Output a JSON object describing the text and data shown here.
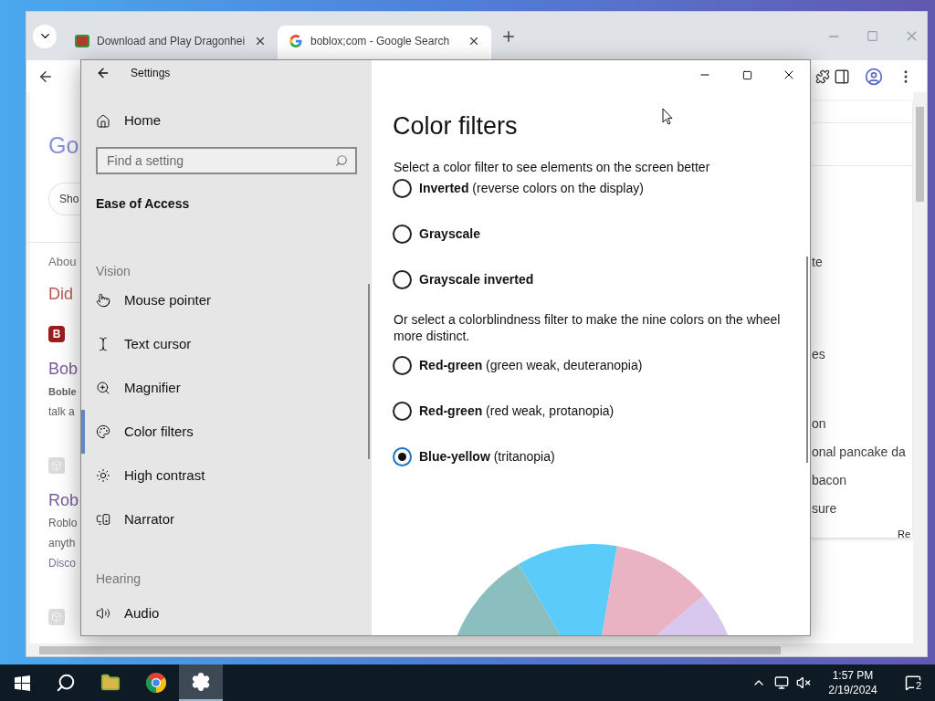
{
  "browser": {
    "tabs": [
      {
        "title": "Download and Play Dragonhei",
        "selected": false
      },
      {
        "title": "boblox;com - Google Search",
        "selected": true
      }
    ],
    "page_left": [
      {
        "kind": "logo",
        "text": "Go"
      },
      {
        "kind": "chip",
        "text": "Sho"
      },
      {
        "kind": "caption",
        "text": "Abou"
      },
      {
        "kind": "question",
        "text": "Did"
      },
      {
        "kind": "site-icon",
        "text": "B"
      },
      {
        "kind": "title",
        "text": "Bob"
      },
      {
        "kind": "bold",
        "text": "Boble"
      },
      {
        "kind": "snippet",
        "text": "talk a"
      },
      {
        "kind": "faint-icon"
      },
      {
        "kind": "title",
        "text": "Rob"
      },
      {
        "kind": "snippet",
        "text": "Roblo"
      },
      {
        "kind": "snippet",
        "text": "anyth"
      },
      {
        "kind": "link",
        "text": "Disco"
      },
      {
        "kind": "faint-icon"
      }
    ],
    "page_right": [
      {
        "kind": "text",
        "text": "te"
      },
      {
        "kind": "text",
        "text": "es"
      },
      {
        "kind": "text",
        "text": "on"
      },
      {
        "kind": "text",
        "text": "onal pancake da"
      },
      {
        "kind": "text",
        "text": "bacon"
      },
      {
        "kind": "text",
        "text": "sure"
      },
      {
        "kind": "small",
        "text": "Re"
      }
    ]
  },
  "settings": {
    "title": "Settings",
    "home": "Home",
    "search_placeholder": "Find a setting",
    "section": "Ease of Access",
    "groups": [
      {
        "heading": "Vision",
        "items": [
          {
            "label": "Mouse pointer",
            "selected": false
          },
          {
            "label": "Text cursor",
            "selected": false
          },
          {
            "label": "Magnifier",
            "selected": false
          },
          {
            "label": "Color filters",
            "selected": true
          },
          {
            "label": "High contrast",
            "selected": false
          },
          {
            "label": "Narrator",
            "selected": false
          }
        ]
      },
      {
        "heading": "Hearing",
        "items": [
          {
            "label": "Audio",
            "selected": false
          }
        ]
      }
    ],
    "page": {
      "title": "Color filters",
      "intro": "Select a color filter to see elements on the screen better",
      "filters": [
        {
          "name": "Inverted",
          "detail": "(reverse colors on the display)",
          "selected": false
        },
        {
          "name": "Grayscale",
          "selected": false
        },
        {
          "name": "Grayscale inverted",
          "selected": false
        }
      ],
      "colorblind_intro": "Or select a colorblindness filter to make the nine colors on the wheel more distinct.",
      "colorblind_filters": [
        {
          "name": "Red-green",
          "detail": "(green weak, deuteranopia)",
          "selected": false
        },
        {
          "name": "Red-green",
          "detail": "(red weak, protanopia)",
          "selected": false
        },
        {
          "name": "Blue-yellow",
          "detail": "(tritanopia)",
          "selected": true
        }
      ]
    }
  },
  "taskbar": {
    "time": "1:57 PM",
    "date": "2/19/2024",
    "notifications": "2"
  }
}
